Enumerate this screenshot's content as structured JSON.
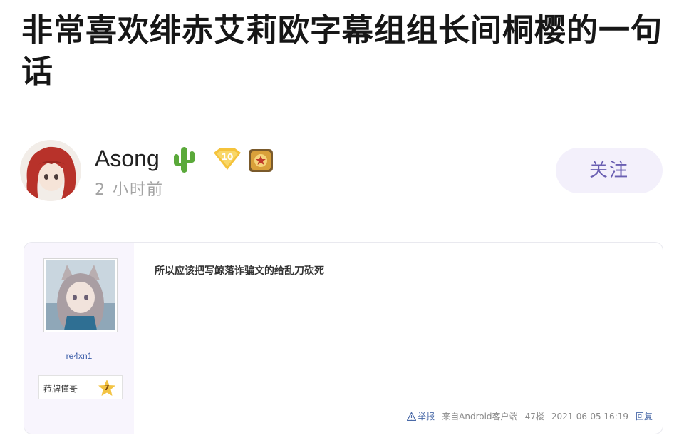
{
  "article": {
    "title": "非常喜欢绯赤艾莉欧字幕组组长间桐樱的一句话"
  },
  "author": {
    "name": "Asong",
    "time": "2 小时前",
    "level_badge": "10",
    "follow_label": "关注",
    "badges": [
      "cactus-icon",
      "level-badge-icon",
      "medal-icon"
    ]
  },
  "quoted_post": {
    "username": "re4xn1",
    "rank_title": "菈牌懂哥",
    "rank_level": "7",
    "content": "所以应该把写鲸落诈骗文的给乱刀砍死",
    "footer": {
      "report": "举报",
      "source": "来自Android客户端",
      "floor": "47楼",
      "datetime": "2021-06-05 16:19",
      "reply": "回复"
    }
  },
  "colors": {
    "follow_bg": "#f3f0fb",
    "follow_text": "#6a5fb2",
    "link": "#3a5ca8"
  }
}
